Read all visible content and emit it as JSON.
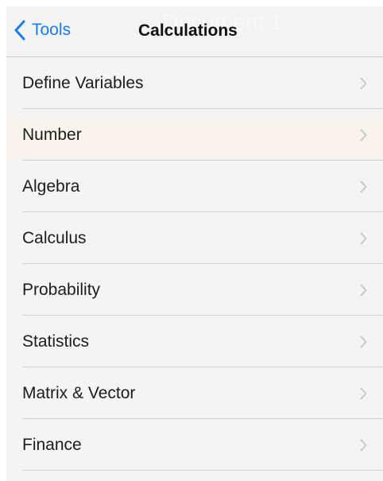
{
  "header": {
    "back_label": "Tools",
    "title": "Calculations",
    "background_title": "Document 1"
  },
  "menu": {
    "items": [
      {
        "label": "Define Variables",
        "icon": "chevron-right-icon"
      },
      {
        "label": "Number",
        "icon": "chevron-right-icon"
      },
      {
        "label": "Algebra",
        "icon": "chevron-right-icon"
      },
      {
        "label": "Calculus",
        "icon": "chevron-right-icon"
      },
      {
        "label": "Probability",
        "icon": "chevron-right-icon"
      },
      {
        "label": "Statistics",
        "icon": "chevron-right-icon"
      },
      {
        "label": "Matrix & Vector",
        "icon": "chevron-right-icon"
      },
      {
        "label": "Finance",
        "icon": "chevron-right-icon"
      }
    ]
  },
  "colors": {
    "accent": "#1a7cf5",
    "text": "#1c1c1c",
    "chevron": "#c7c7cc",
    "separator": "#d1d1d6",
    "background": "#f4f4f5"
  }
}
